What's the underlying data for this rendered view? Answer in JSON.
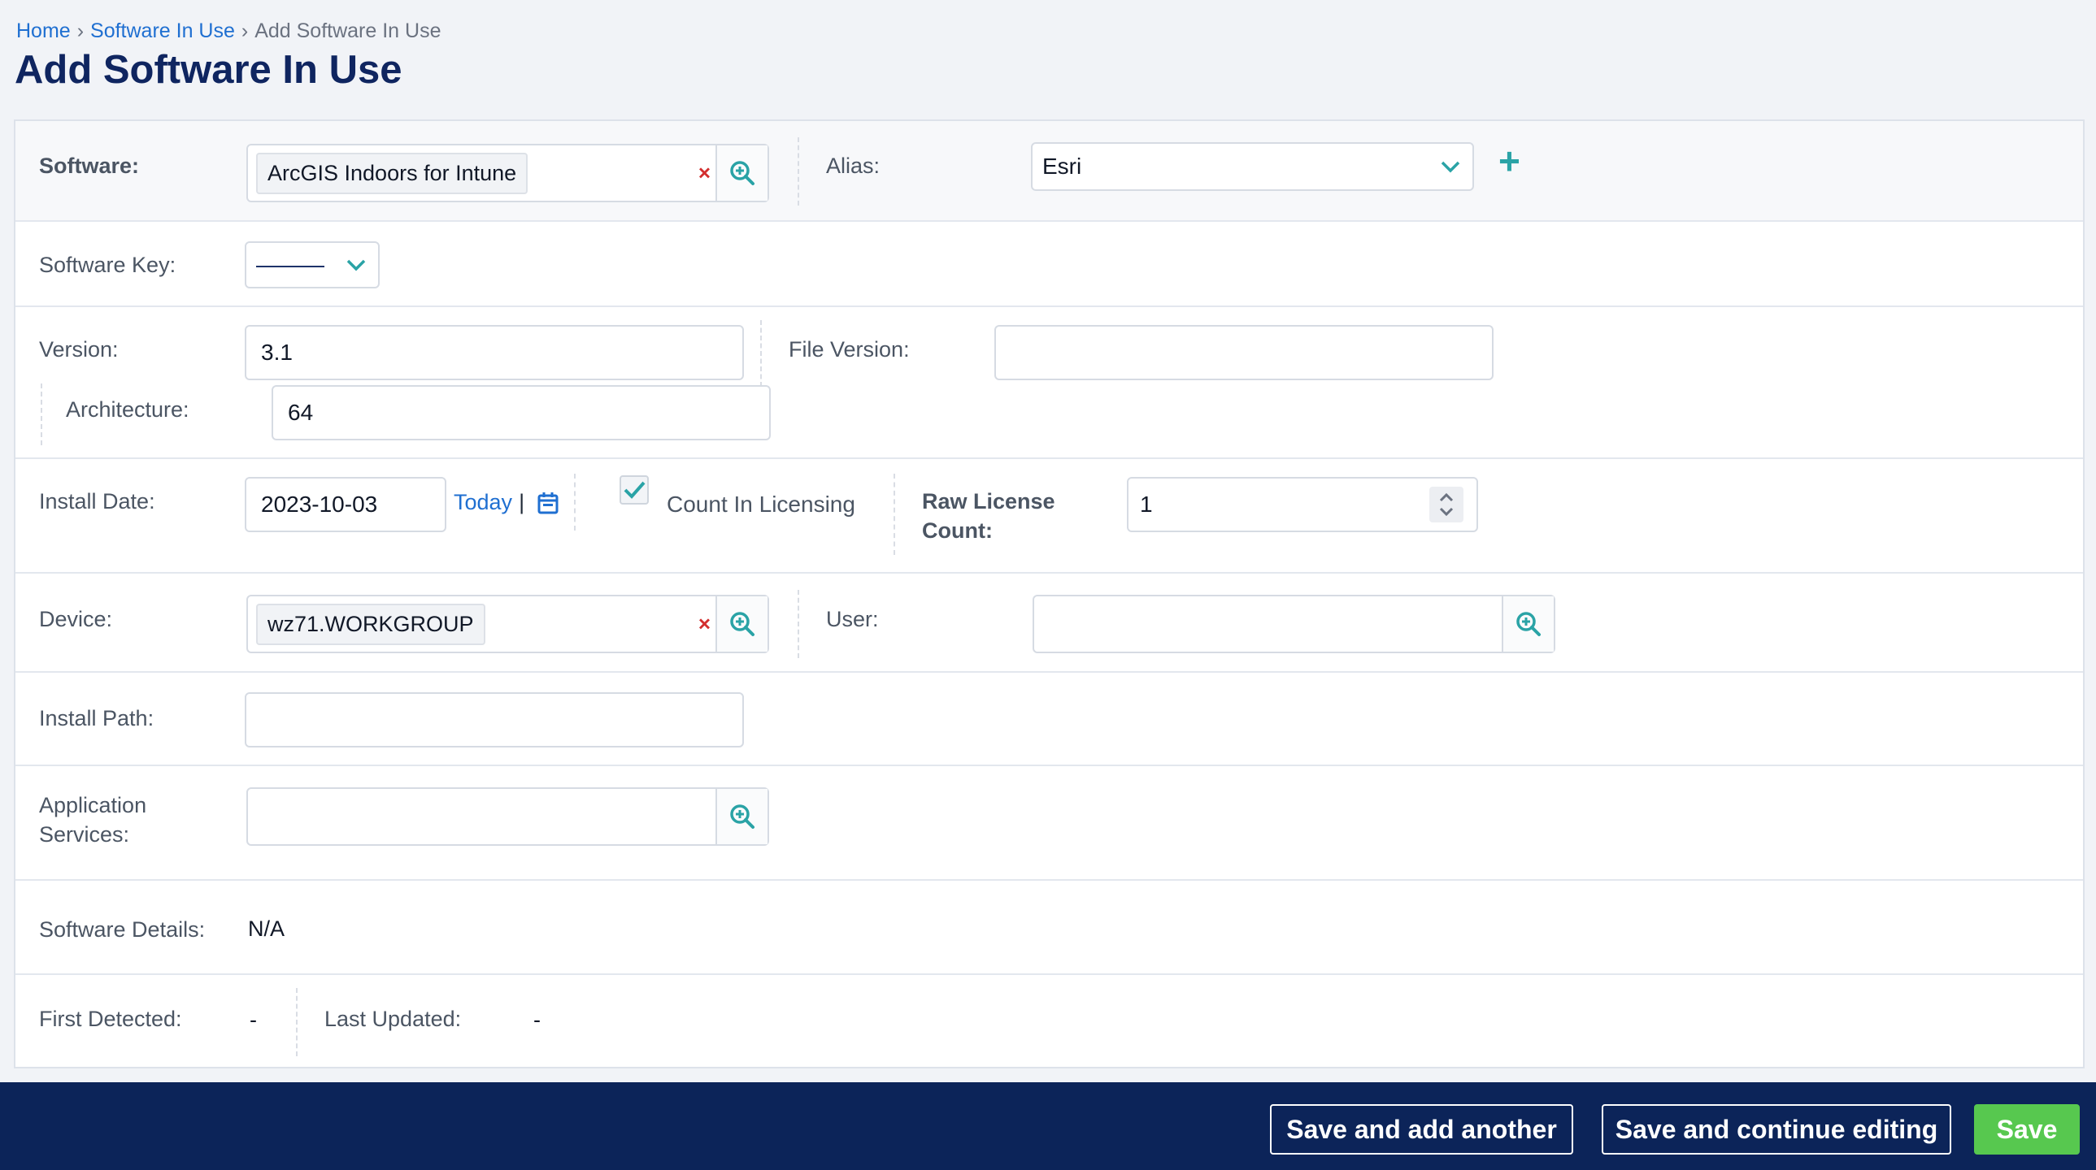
{
  "breadcrumb": {
    "home": "Home",
    "section": "Software In Use",
    "current": "Add Software In Use",
    "separator": "›"
  },
  "page_title": "Add Software In Use",
  "form": {
    "software": {
      "label": "Software:",
      "value": "ArcGIS Indoors for Intune",
      "clear": "×"
    },
    "alias": {
      "label": "Alias:",
      "value": "Esri",
      "add": "+"
    },
    "software_key": {
      "label": "Software Key:",
      "value": "———"
    },
    "version": {
      "label": "Version:",
      "value": "3.1"
    },
    "file_version": {
      "label": "File Version:",
      "value": ""
    },
    "architecture": {
      "label": "Architecture:",
      "value": "64"
    },
    "install_date": {
      "label": "Install Date:",
      "value": "2023-10-03",
      "today": "Today",
      "sep": "|"
    },
    "count_in_licensing": {
      "label": "Count In Licensing",
      "checked": true
    },
    "raw_license_count": {
      "label_line1": "Raw License",
      "label_line2": "Count:",
      "value": "1"
    },
    "device": {
      "label": "Device:",
      "value": "wz71.WORKGROUP",
      "clear": "×"
    },
    "user": {
      "label": "User:",
      "value": ""
    },
    "install_path": {
      "label": "Install Path:",
      "value": ""
    },
    "application_services": {
      "label_line1": "Application",
      "label_line2": "Services:",
      "value": ""
    },
    "software_details": {
      "label": "Software Details:",
      "value": "N/A"
    },
    "first_detected": {
      "label": "First Detected:",
      "value": "-"
    },
    "last_updated": {
      "label": "Last Updated:",
      "value": "-"
    }
  },
  "footer": {
    "save_add_another": "Save and add another",
    "save_continue": "Save and continue editing",
    "save": "Save"
  },
  "colors": {
    "title": "#0f2560",
    "link": "#1f6fd1",
    "accent_teal": "#2aa3a6",
    "footer_bg": "#0c2459",
    "save_green": "#57c84f",
    "clear_red": "#d32f2f"
  },
  "icons": [
    "zoom-in-icon",
    "chevron-down-icon",
    "plus-icon",
    "calendar-icon",
    "check-icon",
    "spinner-arrows-icon",
    "clear-icon"
  ]
}
